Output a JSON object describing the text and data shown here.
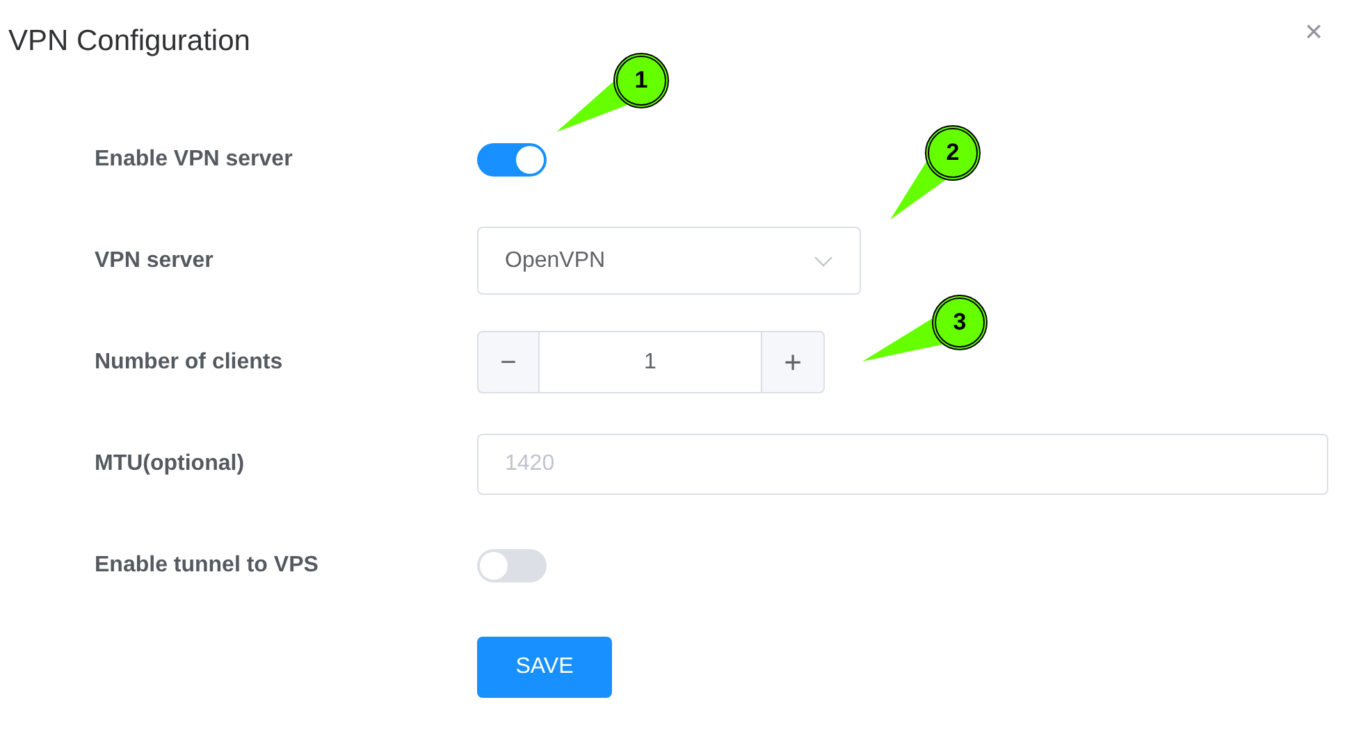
{
  "dialog": {
    "title": "VPN Configuration",
    "close": "×"
  },
  "fields": [
    {
      "kind": "toggle",
      "label": "Enable VPN server",
      "on": true
    },
    {
      "kind": "select",
      "label": "VPN server",
      "value": "OpenVPN"
    },
    {
      "kind": "stepper",
      "label": "Number of clients",
      "value": "1",
      "minus": "−",
      "plus": "+"
    },
    {
      "kind": "input",
      "label": "MTU(optional)",
      "placeholder": "1420"
    },
    {
      "kind": "toggle",
      "label": "Enable tunnel to VPS",
      "on": false
    }
  ],
  "save_button": "SAVE",
  "callouts": [
    {
      "label": "1"
    },
    {
      "label": "2"
    },
    {
      "label": "3"
    }
  ]
}
